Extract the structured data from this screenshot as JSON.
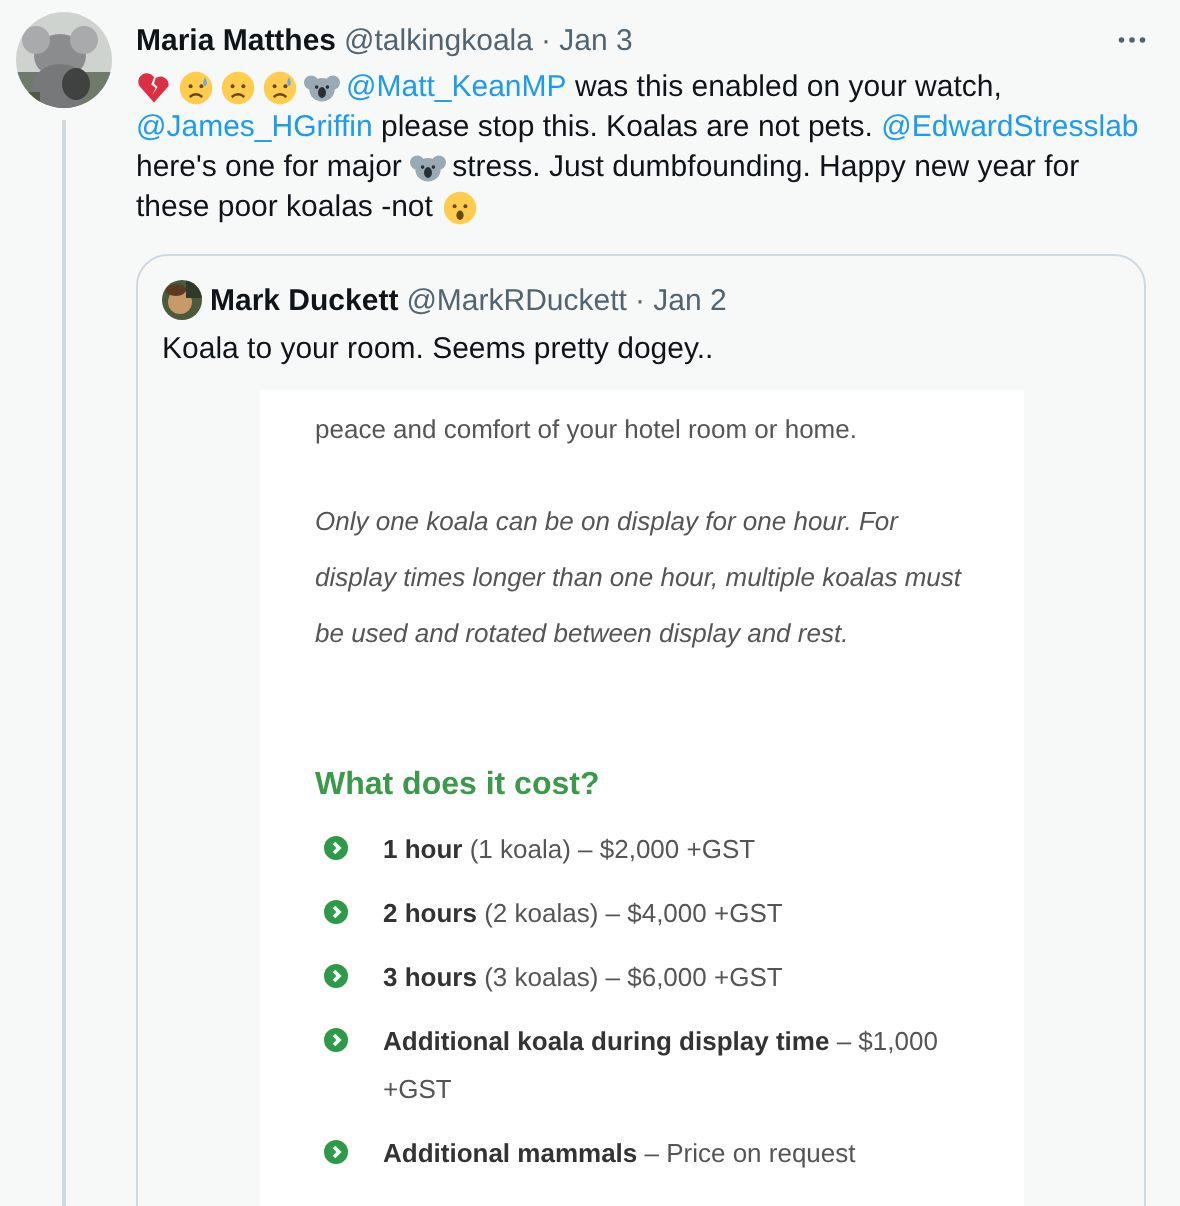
{
  "tweet": {
    "author": "Maria Matthes",
    "handle": "@talkingkoala",
    "time": "· Jan 3",
    "lines": [
      [
        {
          "kind": "heart"
        },
        {
          "kind": "sweat"
        },
        {
          "kind": "worried"
        },
        {
          "kind": "cry"
        },
        {
          "kind": "koala"
        },
        {
          "kind": "mention",
          "text": "@Matt_KeanMP"
        },
        {
          "kind": "text",
          "text": " was this enabled on your watch,"
        }
      ],
      [
        {
          "kind": "mention",
          "text": "@James_HGriffin"
        },
        {
          "kind": "text",
          "text": " please stop this. Koalas are not pets. "
        },
        {
          "kind": "mention",
          "text": "@EdwardStresslab"
        }
      ],
      [
        {
          "kind": "text",
          "text": "here's one for major "
        },
        {
          "kind": "koala"
        },
        {
          "kind": "text",
          "text": "stress. Just dumbfounding. Happy new year for"
        }
      ],
      [
        {
          "kind": "text",
          "text": "these poor koalas -not "
        },
        {
          "kind": "surprised"
        }
      ]
    ]
  },
  "quote": {
    "author": "Mark Duckett",
    "handle": "@MarkRDuckett",
    "time": "· Jan 2",
    "text": "Koala to your room. Seems pretty dogey..",
    "document": {
      "intro": "peace and comfort of your hotel room or home.",
      "note_lines": [
        "Only one koala can be on display for one hour. For",
        "display times longer than one hour, multiple koalas must",
        "be used and rotated between display and rest."
      ],
      "heading": "What does it cost?",
      "items": [
        [
          "**1 hour** (1 koala) – $2,000 +GST"
        ],
        [
          "**2 hours** (2 koalas) – $4,000 +GST"
        ],
        [
          "**3 hours** (3 koalas) – $6,000 +GST"
        ],
        [
          "**Additional koala during display time** – $1,000",
          "+GST"
        ],
        [
          "**Additional mammals** – Price on request"
        ]
      ]
    }
  }
}
